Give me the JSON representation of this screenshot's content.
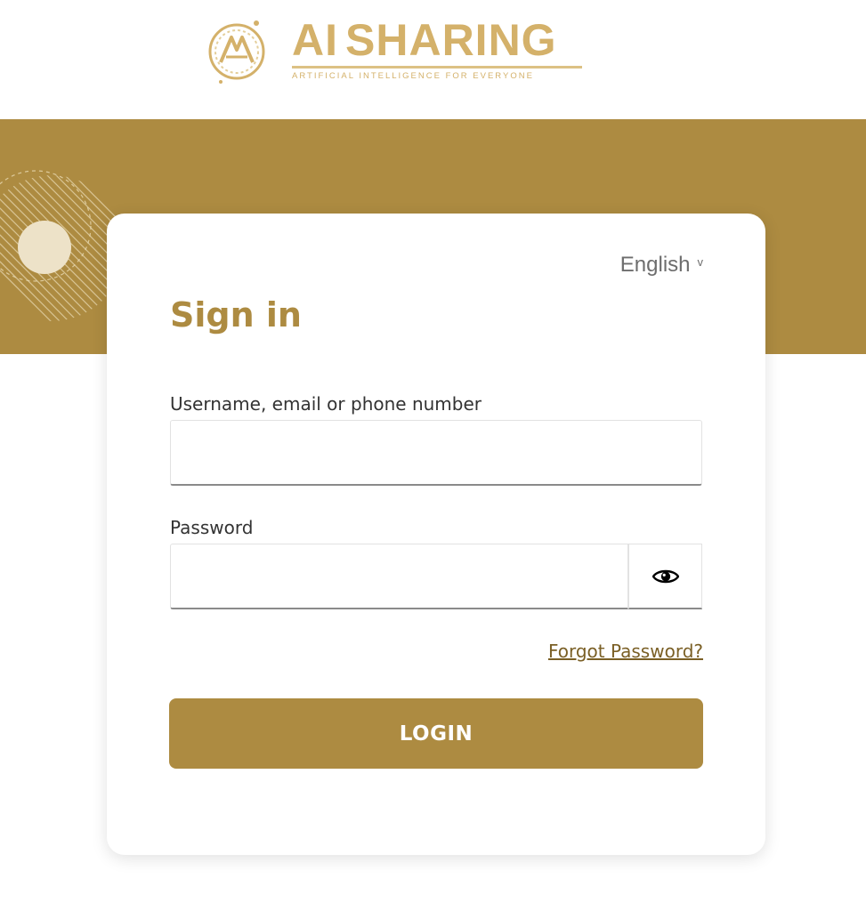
{
  "brand": {
    "name_part1": "AI",
    "name_part2": "SHARING",
    "tagline": "ARTIFICIAL INTELLIGENCE FOR EVERYONE",
    "logo_color": "#d4b16a"
  },
  "theme": {
    "band_color": "#ad8b41",
    "accent": "#ad8b41",
    "link_color": "#7a5f25"
  },
  "language": {
    "selected": "English",
    "caret": "v"
  },
  "form": {
    "title": "Sign in",
    "username": {
      "label": "Username, email or phone number",
      "value": ""
    },
    "password": {
      "label": "Password",
      "value": ""
    },
    "show_password_icon": "eye-icon",
    "forgot_link": "Forgot Password?",
    "login_button": "LOGIN"
  }
}
